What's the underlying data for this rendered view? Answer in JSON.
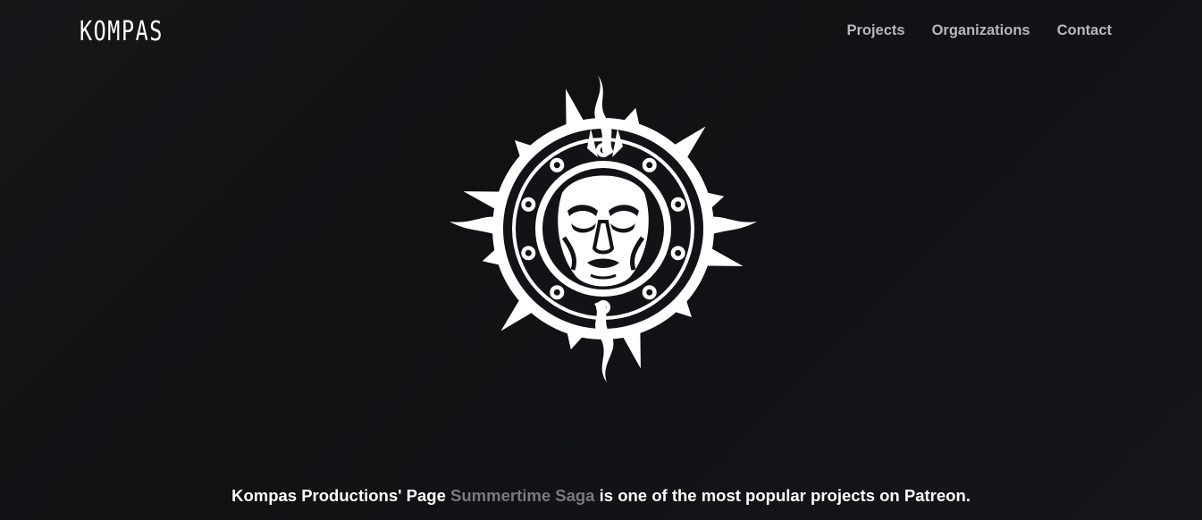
{
  "header": {
    "logo_text": "KOMPAS",
    "nav": [
      {
        "label": "Projects"
      },
      {
        "label": "Organizations"
      },
      {
        "label": "Contact"
      }
    ]
  },
  "hero": {
    "emblem_icon": "sun-face-emblem-icon"
  },
  "tagline": {
    "before": "Kompas Productions' Page ",
    "link_text": "Summertime Saga",
    "after": " is one of the most popular projects on Patreon."
  },
  "colors": {
    "background": "#131317",
    "nav_text": "#b6b7bb",
    "link_text": "#7a7a7e",
    "text": "#ffffff"
  }
}
